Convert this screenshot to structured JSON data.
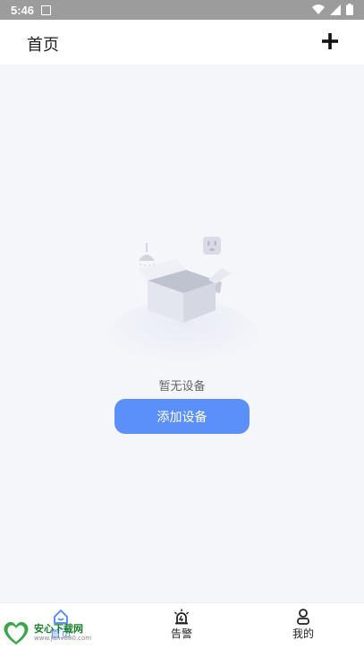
{
  "status_bar": {
    "time": "5:46"
  },
  "appbar": {
    "title": "首页",
    "add_icon": "plus-icon"
  },
  "empty_state": {
    "message": "暂无设备",
    "button_label": "添加设备",
    "illustration": "empty-box-icon"
  },
  "bottom_nav": {
    "items": [
      {
        "label": "首页",
        "icon": "home-icon"
      },
      {
        "label": "告警",
        "icon": "alarm-icon"
      },
      {
        "label": "我的",
        "icon": "user-icon"
      }
    ]
  },
  "watermark": {
    "brand": "安心下载网",
    "url": "www.janv800.com"
  },
  "colors": {
    "accent": "#5b8ff9",
    "status_bar": "#9c9c9c",
    "background": "#f5f6fa"
  }
}
